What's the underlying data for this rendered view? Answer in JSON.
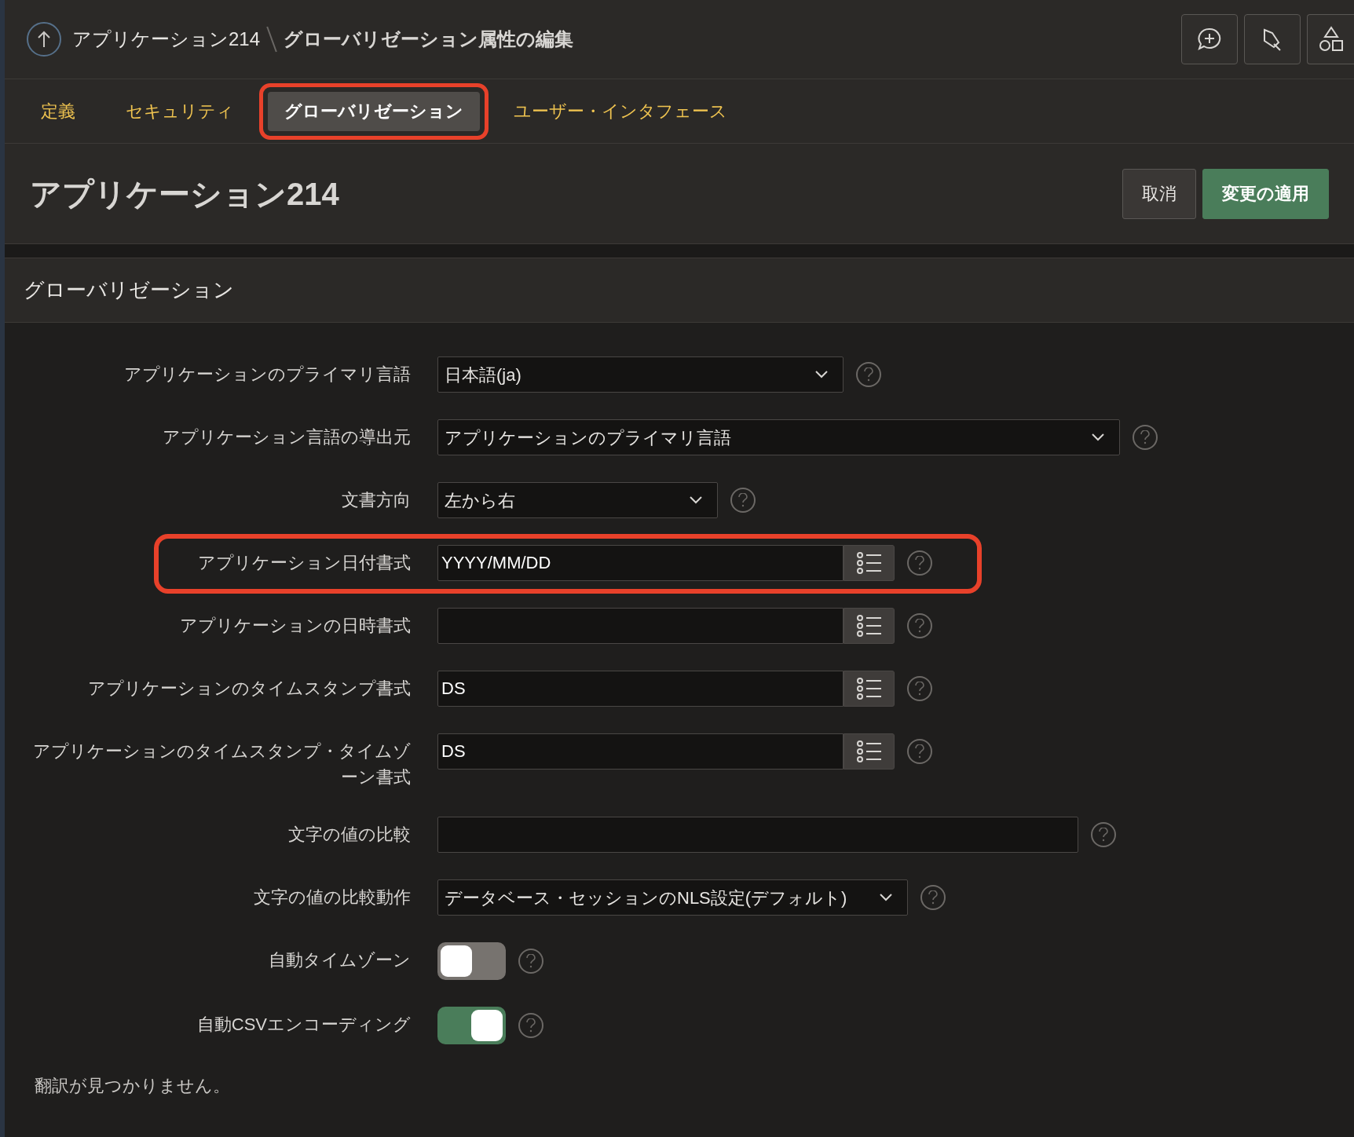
{
  "header": {
    "breadcrumb": [
      {
        "label": "アプリケーション214"
      },
      {
        "label": "グローバリゼーション属性の編集"
      }
    ]
  },
  "tabs": [
    {
      "label": "定義",
      "selected": false,
      "highlighted": false
    },
    {
      "label": "セキュリティ",
      "selected": false,
      "highlighted": false
    },
    {
      "label": "グローバリゼーション",
      "selected": true,
      "highlighted": true
    },
    {
      "label": "ユーザー・インタフェース",
      "selected": false,
      "highlighted": false
    }
  ],
  "page": {
    "title": "アプリケーション214",
    "buttons": [
      {
        "label": "取消",
        "kind": "secondary"
      },
      {
        "label": "変更の適用",
        "kind": "primary"
      }
    ]
  },
  "region": {
    "title": "グローバリゼーション",
    "fields": [
      {
        "label": "アプリケーションのプライマリ言語",
        "kind": "select",
        "value": "日本語(ja)",
        "highlighted": false
      },
      {
        "label": "アプリケーション言語の導出元",
        "kind": "select",
        "value": "アプリケーションのプライマリ言語",
        "highlighted": false
      },
      {
        "label": "文書方向",
        "kind": "select",
        "value": "左から右",
        "highlighted": false
      },
      {
        "label": "アプリケーション日付書式",
        "kind": "lov",
        "value": "YYYY/MM/DD",
        "highlighted": true
      },
      {
        "label": "アプリケーションの日時書式",
        "kind": "lov",
        "highlighted": false
      },
      {
        "label": "アプリケーションのタイムスタンプ書式",
        "kind": "lov",
        "value": "DS",
        "highlighted": false
      },
      {
        "label": "アプリケーションのタイムスタンプ・タイムゾーン書式",
        "kind": "lov",
        "value": "DS",
        "highlighted": false
      },
      {
        "label": "文字の値の比較",
        "kind": "text",
        "highlighted": false
      },
      {
        "label": "文字の値の比較動作",
        "kind": "select",
        "value": "データベース・セッションのNLS設定(デフォルト)",
        "highlighted": false
      },
      {
        "label": "自動タイムゾーン",
        "kind": "switch",
        "on": false,
        "highlighted": false
      },
      {
        "label": "自動CSVエンコーディング",
        "kind": "switch",
        "on": true,
        "highlighted": false
      }
    ],
    "footer_note": "翻訳が見つかりません。"
  }
}
